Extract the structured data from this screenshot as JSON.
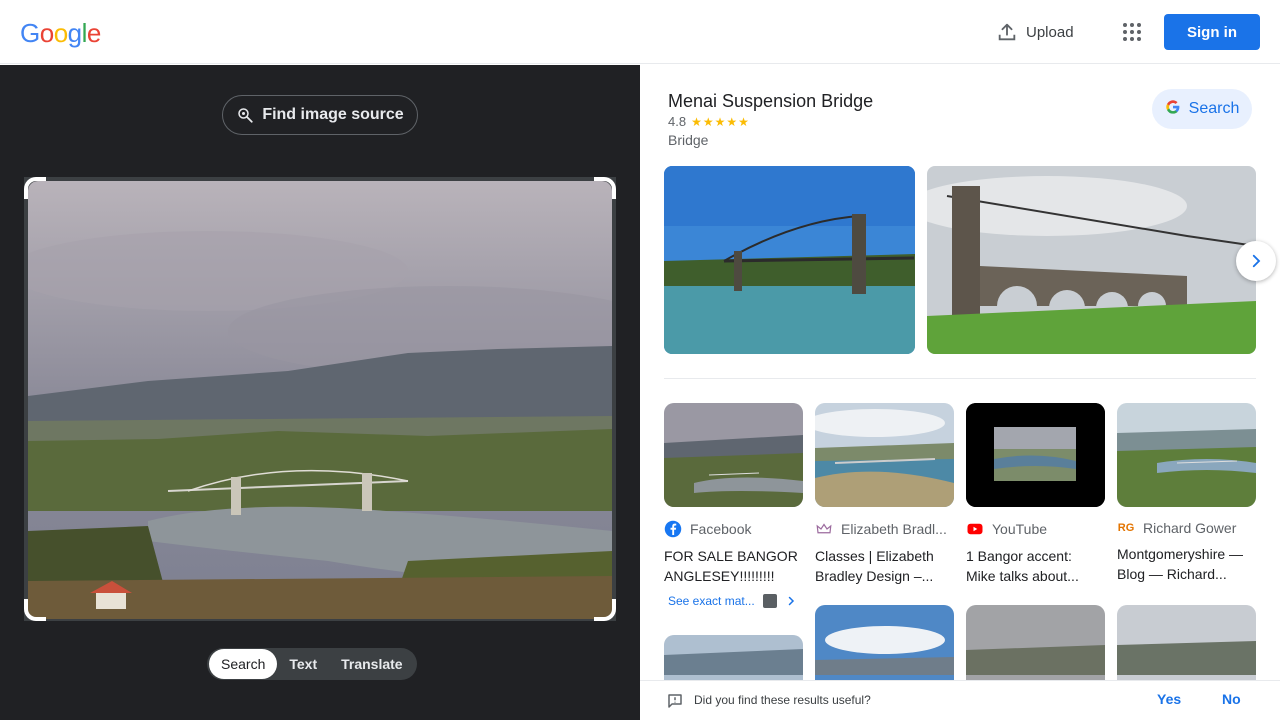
{
  "header": {
    "logo_letters": [
      {
        "char": "G",
        "color": "#4285f4"
      },
      {
        "char": "o",
        "color": "#ea4335"
      },
      {
        "char": "o",
        "color": "#fbbc05"
      },
      {
        "char": "g",
        "color": "#4285f4"
      },
      {
        "char": "l",
        "color": "#34a853"
      },
      {
        "char": "e",
        "color": "#ea4335"
      }
    ],
    "upload_label": "Upload",
    "upload_icon": "upload-icon",
    "apps_icon": "apps-grid-icon",
    "signin_label": "Sign in",
    "signin_color": "#1a73e8"
  },
  "left": {
    "find_source_label": "Find image source",
    "find_source_icon": "lens-search-icon",
    "mode_tabs": [
      {
        "label": "Search",
        "active": true
      },
      {
        "label": "Text",
        "active": false
      },
      {
        "label": "Translate",
        "active": false
      }
    ]
  },
  "knowledge_panel": {
    "title": "Menai Suspension Bridge",
    "rating": "4.8",
    "stars": "★★★★★",
    "type": "Bridge",
    "search_label": "Search",
    "next_icon": "chevron-right-icon"
  },
  "results": [
    {
      "source_name": "Facebook",
      "source_icon": "facebook-icon",
      "source_color": "#1877f2",
      "title": "FOR SALE BANGOR ANGLESEY!!!!!!!!!"
    },
    {
      "source_name": "Elizabeth Bradl...",
      "source_icon": "crown-icon",
      "source_color": "#9c6b9e",
      "title": "Classes | Elizabeth Bradley Design –..."
    },
    {
      "source_name": "YouTube",
      "source_icon": "youtube-icon",
      "source_color": "#ff0000",
      "title": "1 Bangor accent: Mike talks about..."
    },
    {
      "source_name": "Richard Gower",
      "source_icon": "rg-icon",
      "source_color": "#e37400",
      "title": "Montgomeryshire — Blog — Richard..."
    }
  ],
  "see_exact_label": "See exact mat...",
  "feedback": {
    "question": "Did you find these results useful?",
    "yes_label": "Yes",
    "no_label": "No"
  }
}
